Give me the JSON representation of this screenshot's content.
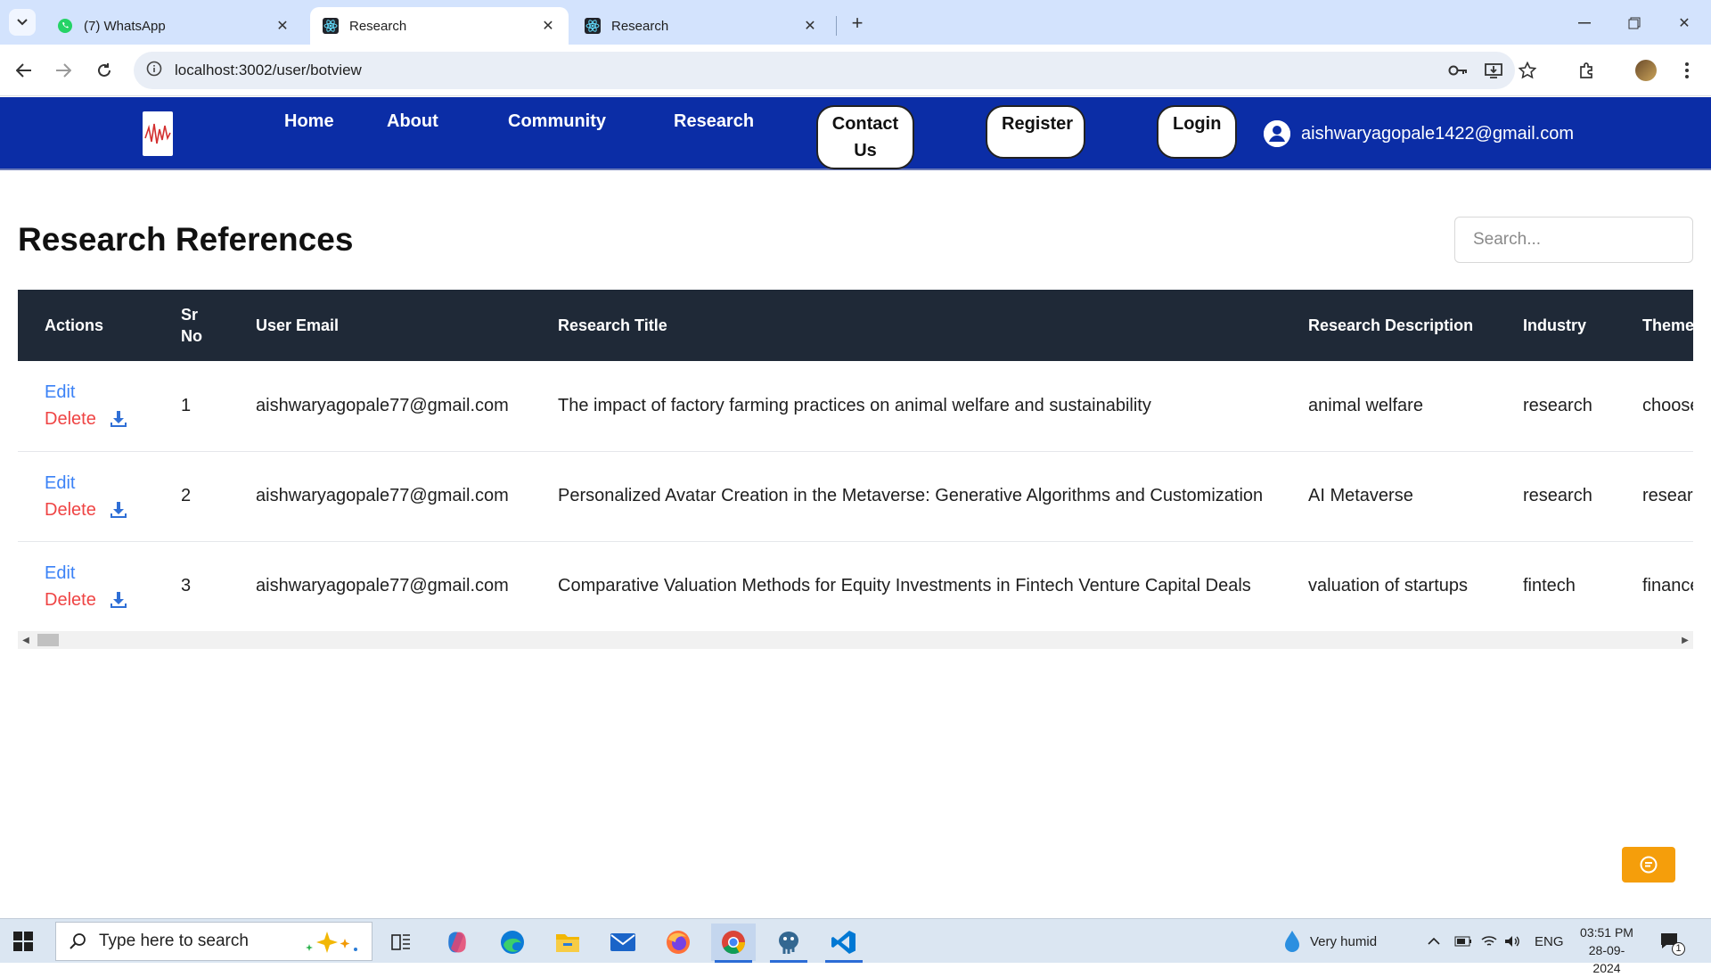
{
  "browser": {
    "tabs": [
      {
        "title": "(7) WhatsApp",
        "icon": "whatsapp-icon"
      },
      {
        "title": "Research",
        "icon": "react-icon",
        "active": true
      },
      {
        "title": "Research",
        "icon": "react-icon"
      }
    ],
    "url": "localhost:3002/user/botview"
  },
  "nav": {
    "links": [
      "Home",
      "About",
      "Community",
      "Research"
    ],
    "contact_label": "Contact Us",
    "register_label": "Register",
    "login_label": "Login",
    "user_email": "aishwaryagopale1422@gmail.com"
  },
  "main": {
    "title": "Research References",
    "search_placeholder": "Search...",
    "columns": {
      "actions": "Actions",
      "sr_no": "Sr No",
      "user_email": "User Email",
      "research_title": "Research Title",
      "research_description": "Research Description",
      "industry": "Industry",
      "themes": "Themes"
    },
    "edit_label": "Edit",
    "delete_label": "Delete",
    "rows": [
      {
        "sr": "1",
        "email": "aishwaryagopale77@gmail.com",
        "title": "The impact of factory farming practices on animal welfare and sustainability",
        "description": "animal welfare",
        "industry": "research",
        "themes": "choose"
      },
      {
        "sr": "2",
        "email": "aishwaryagopale77@gmail.com",
        "title": "Personalized Avatar Creation in the Metaverse: Generative Algorithms and Customization",
        "description": "AI Metaverse",
        "industry": "research",
        "themes": "researc"
      },
      {
        "sr": "3",
        "email": "aishwaryagopale77@gmail.com",
        "title": "Comparative Valuation Methods for Equity Investments in Fintech Venture Capital Deals",
        "description": "valuation of startups",
        "industry": "fintech",
        "themes": "finance"
      }
    ]
  },
  "taskbar": {
    "search_placeholder": "Type here to search",
    "weather": "Very humid",
    "language": "ENG",
    "time": "03:51 PM",
    "date": "28-09-2024",
    "notification_count": "1"
  },
  "colors": {
    "nav_bg": "#0b2da6",
    "table_header_bg": "#1f2937",
    "edit": "#3b82f6",
    "delete": "#ef4444",
    "chat_button": "#f59e0b"
  }
}
